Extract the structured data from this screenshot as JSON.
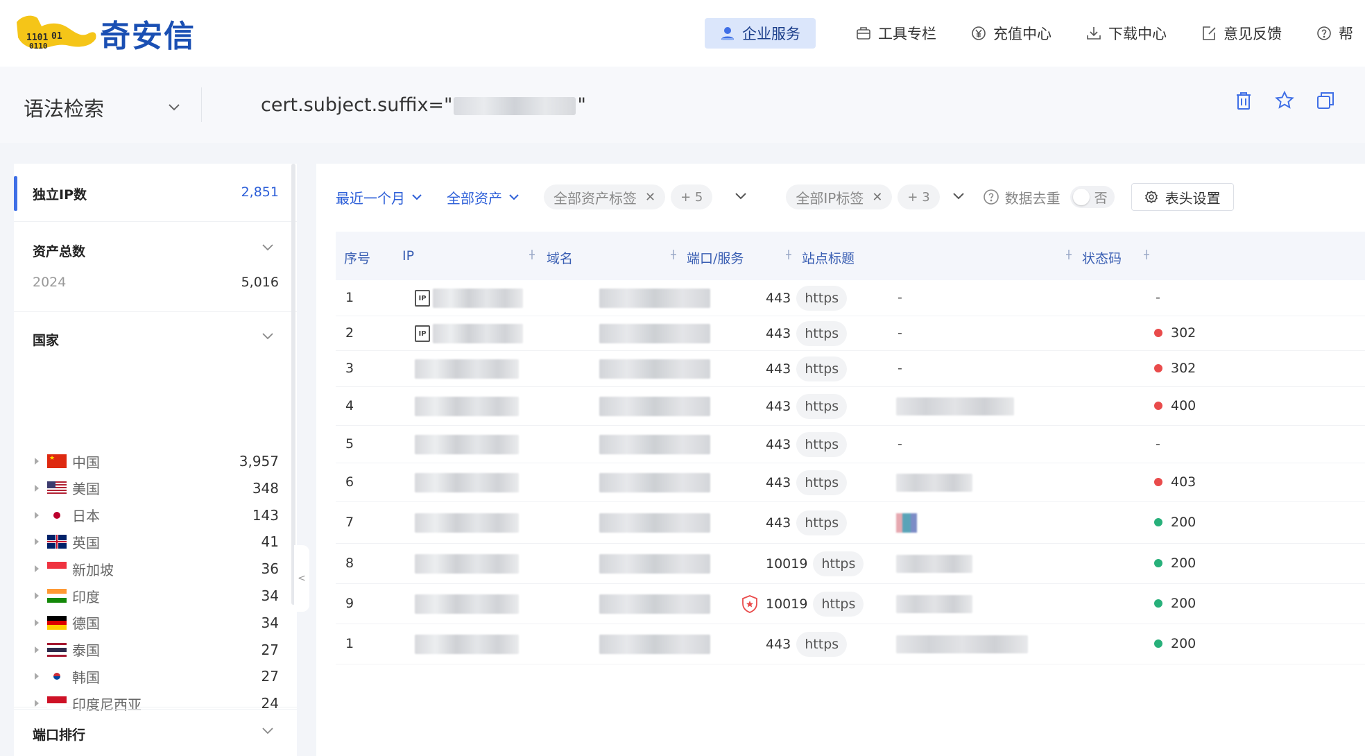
{
  "brand": {
    "name": "奇安信",
    "colors": {
      "primary": "#1a4fb3",
      "accent": "#2d5fd8",
      "logo_yellow": "#f5c518"
    }
  },
  "nav": {
    "items": [
      {
        "label": "企业服务",
        "icon": "user-service-icon",
        "active": true
      },
      {
        "label": "工具专栏",
        "icon": "toolbox-icon"
      },
      {
        "label": "充值中心",
        "icon": "yen-coin-icon"
      },
      {
        "label": "下载中心",
        "icon": "download-icon"
      },
      {
        "label": "意见反馈",
        "icon": "feedback-edit-icon"
      },
      {
        "label": "帮",
        "icon": "help-circle-icon"
      }
    ]
  },
  "search": {
    "mode": "语法检索",
    "query_prefix": "cert.subject.suffix=\"",
    "query_suffix": "\"",
    "actions": [
      "trash-icon",
      "star-icon",
      "copy-icon"
    ]
  },
  "left": {
    "unique_ip": {
      "label": "独立IP数",
      "value": "2,851"
    },
    "total_assets": {
      "label": "资产总数",
      "year": "2024",
      "value": "5,016"
    },
    "country": {
      "title": "国家",
      "items": [
        {
          "name": "中国",
          "count": "3,957",
          "flag": "cn"
        },
        {
          "name": "美国",
          "count": "348",
          "flag": "us"
        },
        {
          "name": "日本",
          "count": "143",
          "flag": "jp"
        },
        {
          "name": "英国",
          "count": "41",
          "flag": "gb"
        },
        {
          "name": "新加坡",
          "count": "36",
          "flag": "sg"
        },
        {
          "name": "印度",
          "count": "34",
          "flag": "in"
        },
        {
          "name": "德国",
          "count": "34",
          "flag": "de"
        },
        {
          "name": "泰国",
          "count": "27",
          "flag": "th"
        },
        {
          "name": "韩国",
          "count": "27",
          "flag": "kr"
        },
        {
          "name": "印度尼西亚",
          "count": "24",
          "flag": "id"
        }
      ]
    },
    "port_rank": {
      "title": "端口排行"
    },
    "collapse": "<"
  },
  "filters": {
    "time": "最近一个月",
    "assets": "全部资产",
    "asset_tags": "全部资产标签",
    "asset_tags_more": "+ 5",
    "ip_tags": "全部IP标签",
    "ip_tags_more": "+ 3",
    "dedupe_label": "数据去重",
    "dedupe_value": "否",
    "header_settings": "表头设置"
  },
  "table": {
    "columns": [
      "序号",
      "IP",
      "域名",
      "端口/服务",
      "站点标题",
      "状态码"
    ],
    "rows": [
      {
        "index": "1",
        "port": "443",
        "service": "https",
        "title": "-",
        "status": "-",
        "status_color": ""
      },
      {
        "index": "2",
        "port": "443",
        "service": "https",
        "title": "-",
        "status": "302",
        "status_color": "#e94b4b"
      },
      {
        "index": "3",
        "port": "443",
        "service": "https",
        "title": "-",
        "status": "302",
        "status_color": "#e94b4b"
      },
      {
        "index": "4",
        "port": "443",
        "service": "https",
        "title": "",
        "status": "400",
        "status_color": "#e94b4b"
      },
      {
        "index": "5",
        "port": "443",
        "service": "https",
        "title": "-",
        "status": "-",
        "status_color": ""
      },
      {
        "index": "6",
        "port": "443",
        "service": "https",
        "title": "",
        "status": "403",
        "status_color": "#e94b4b"
      },
      {
        "index": "7",
        "port": "443",
        "service": "https",
        "title": "",
        "status": "200",
        "status_color": "#27b07a"
      },
      {
        "index": "8",
        "port": "10019",
        "service": "https",
        "title": "",
        "status": "200",
        "status_color": "#27b07a"
      },
      {
        "index": "9",
        "port": "10019",
        "service": "https",
        "title": "",
        "status": "200",
        "status_color": "#27b07a"
      },
      {
        "index": "1",
        "port": "443",
        "service": "https",
        "title": "",
        "status": "200",
        "status_color": "#27b07a"
      }
    ]
  }
}
